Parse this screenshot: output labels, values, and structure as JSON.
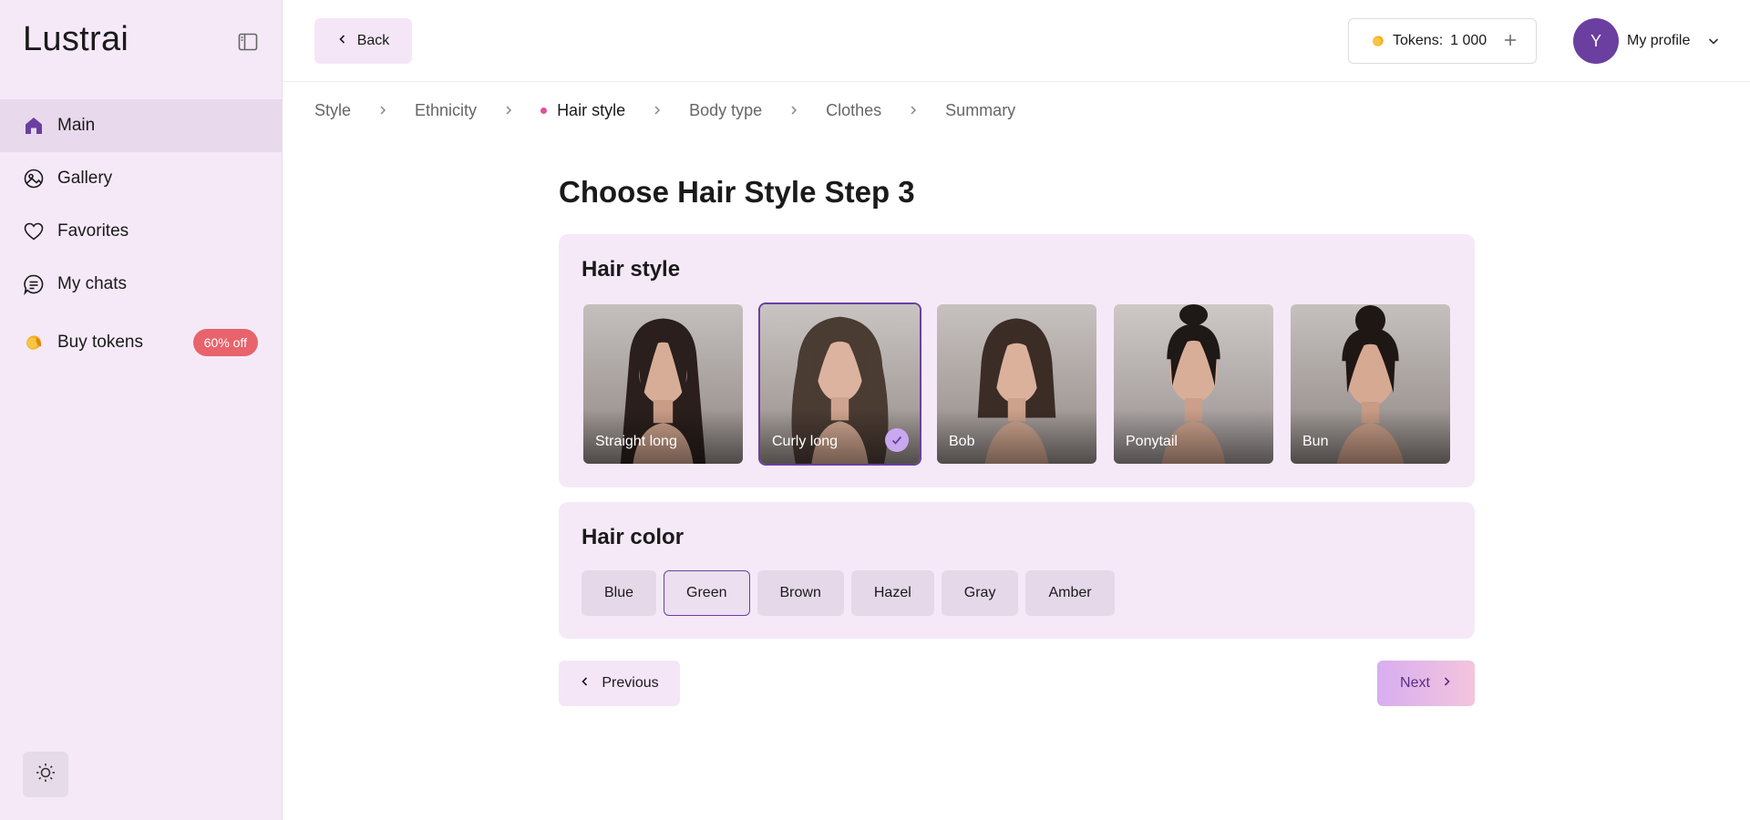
{
  "app": {
    "brand": "Lustrai"
  },
  "sidebar": {
    "items": [
      {
        "label": "Main",
        "icon": "home-icon",
        "active": true
      },
      {
        "label": "Gallery",
        "icon": "gallery-icon"
      },
      {
        "label": "Favorites",
        "icon": "heart-icon"
      },
      {
        "label": "My chats",
        "icon": "chat-icon"
      },
      {
        "label": "Buy tokens",
        "icon": "coin-icon",
        "badge": "60% off"
      }
    ],
    "theme_toggle_icon": "sun-icon"
  },
  "topbar": {
    "back_label": "Back",
    "tokens_label": "Tokens:",
    "tokens_value": "1 000",
    "avatar_initial": "Y",
    "profile_label": "My profile"
  },
  "breadcrumb": [
    {
      "label": "Style"
    },
    {
      "label": "Ethnicity"
    },
    {
      "label": "Hair style",
      "active": true
    },
    {
      "label": "Body type"
    },
    {
      "label": "Clothes"
    },
    {
      "label": "Summary"
    }
  ],
  "main": {
    "title": "Choose Hair Style Step 3",
    "hair_style": {
      "title": "Hair style",
      "options": [
        {
          "label": "Straight long"
        },
        {
          "label": "Curly long",
          "selected": true
        },
        {
          "label": "Bob"
        },
        {
          "label": "Ponytail"
        },
        {
          "label": "Bun"
        }
      ]
    },
    "hair_color": {
      "title": "Hair color",
      "options": [
        {
          "label": "Blue"
        },
        {
          "label": "Green",
          "selected": true
        },
        {
          "label": "Brown"
        },
        {
          "label": "Hazel"
        },
        {
          "label": "Gray"
        },
        {
          "label": "Amber"
        }
      ]
    },
    "previous_label": "Previous",
    "next_label": "Next"
  },
  "colors": {
    "sidebar_bg": "#f5e9f8",
    "accent": "#6b3fa0",
    "badge": "#e8636b",
    "breadcrumb_dot": "#e0519a"
  }
}
